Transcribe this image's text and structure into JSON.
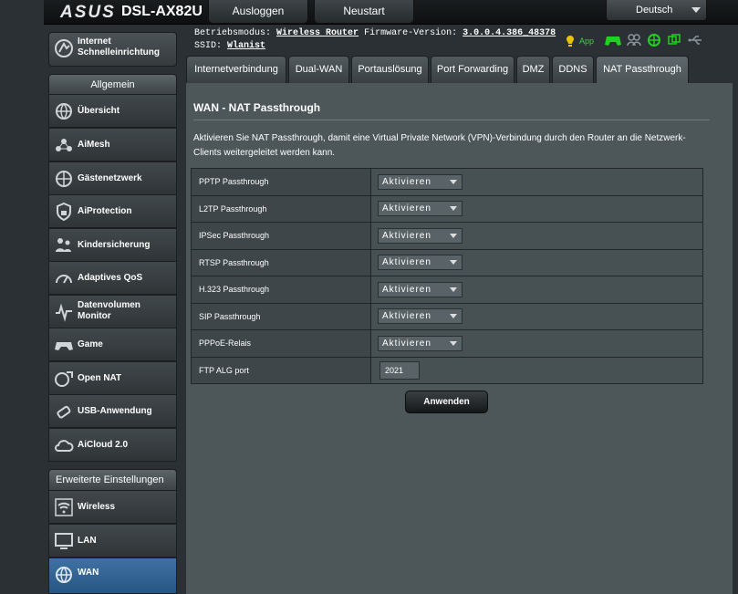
{
  "header": {
    "brand": "ASUS",
    "model": "DSL-AX82U",
    "logout_label": "Ausloggen",
    "restart_label": "Neustart",
    "language": "Deutsch"
  },
  "status": {
    "mode_label": "Betriebsmodus:",
    "mode_value": "Wireless Router",
    "firmware_label": "Firmware-Version:",
    "firmware_value": "3.0.0.4.386_48378",
    "ssid_label": "SSID:",
    "ssid_value": "Wlanist",
    "app_label": "App"
  },
  "sidebar": {
    "quick_setup": "Internet Schnelleinrichtung",
    "general_header": "Allgemein",
    "general_items": [
      {
        "label": "Übersicht"
      },
      {
        "label": "AiMesh"
      },
      {
        "label": "Gästenetzwerk"
      },
      {
        "label": "AiProtection"
      },
      {
        "label": "Kindersicherung"
      },
      {
        "label": "Adaptives QoS"
      },
      {
        "label": "Datenvolumen Monitor"
      },
      {
        "label": "Game"
      },
      {
        "label": "Open NAT"
      },
      {
        "label": "USB-Anwendung"
      },
      {
        "label": "AiCloud 2.0"
      }
    ],
    "advanced_header": "Erweiterte Einstellungen",
    "advanced_items": [
      {
        "label": "Wireless"
      },
      {
        "label": "LAN"
      },
      {
        "label": "WAN"
      }
    ]
  },
  "tabs": [
    {
      "label": "Internetverbindung"
    },
    {
      "label": "Dual-WAN"
    },
    {
      "label": "Portauslösung"
    },
    {
      "label": "Port Forwarding"
    },
    {
      "label": "DMZ"
    },
    {
      "label": "DDNS"
    },
    {
      "label": "NAT Passthrough"
    }
  ],
  "page": {
    "title": "WAN - NAT Passthrough",
    "description": "Aktivieren Sie NAT Passthrough, damit eine Virtual Private Network (VPN)-Verbindung durch den Router an die Netzwerk-Clients weitergeleitet werden kann.",
    "rows": [
      {
        "label": "PPTP Passthrough",
        "value": "Aktivieren"
      },
      {
        "label": "L2TP Passthrough",
        "value": "Aktivieren"
      },
      {
        "label": "IPSec Passthrough",
        "value": "Aktivieren"
      },
      {
        "label": "RTSP Passthrough",
        "value": "Aktivieren"
      },
      {
        "label": "H.323 Passthrough",
        "value": "Aktivieren"
      },
      {
        "label": "SIP Passthrough",
        "value": "Aktivieren"
      },
      {
        "label": "PPPoE-Relais",
        "value": "Aktivieren"
      }
    ],
    "ftp_label": "FTP ALG port",
    "ftp_value": "2021",
    "apply_label": "Anwenden"
  }
}
